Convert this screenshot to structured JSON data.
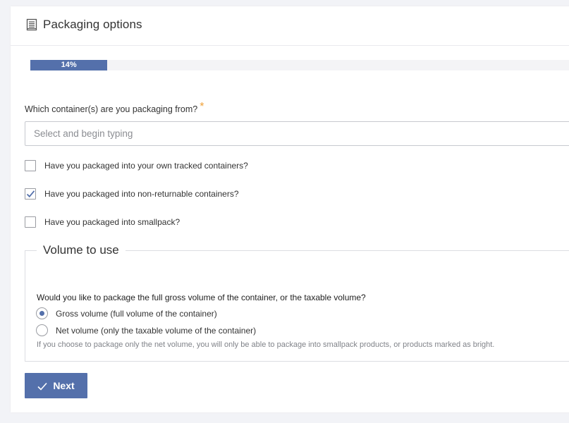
{
  "header": {
    "icon": "document-stack-icon",
    "title": "Packaging options"
  },
  "progress": {
    "percent": 14,
    "label": "14%",
    "color": "#5470ab"
  },
  "container_field": {
    "label": "Which container(s) are you packaging from?",
    "required_marker": "*",
    "placeholder": "Select and begin typing",
    "value": ""
  },
  "checkboxes": [
    {
      "label": "Have you packaged into your own tracked containers?",
      "checked": false
    },
    {
      "label": "Have you packaged into non-returnable containers?",
      "checked": true
    },
    {
      "label": "Have you packaged into smallpack?",
      "checked": false
    }
  ],
  "volume": {
    "legend": "Volume to use",
    "question": "Would you like to package the full gross volume of the container, or the taxable volume?",
    "options": [
      {
        "label": "Gross volume (full volume of the container)",
        "selected": true
      },
      {
        "label": "Net volume (only the taxable volume of the container)",
        "selected": false
      }
    ],
    "help": "If you choose to package only the net volume, you will only be able to package into smallpack products, or products marked as bright."
  },
  "next_button": {
    "label": "Next",
    "icon": "checkmark-icon"
  },
  "colors": {
    "accent": "#5470ab",
    "required": "#f0a23a"
  }
}
